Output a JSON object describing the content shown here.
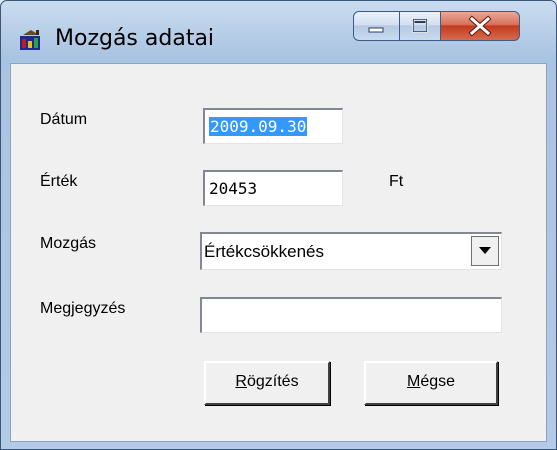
{
  "window": {
    "title": "Mozgás adatai",
    "icon": "app-icon"
  },
  "form": {
    "date_label": "Dátum",
    "date_value": "2009.09.30",
    "value_label": "Érték",
    "value_value": "20453",
    "currency_unit": "Ft",
    "movement_label": "Mozgás",
    "movement_value": "Értékcsökkenés",
    "note_label": "Megjegyzés",
    "note_value": ""
  },
  "buttons": {
    "save_mnemonic": "R",
    "save_rest": "ögzítés",
    "cancel_mnemonic": "M",
    "cancel_rest": "égse"
  },
  "colors": {
    "selection": "#3399ff",
    "close_button": "#c23b1f"
  }
}
